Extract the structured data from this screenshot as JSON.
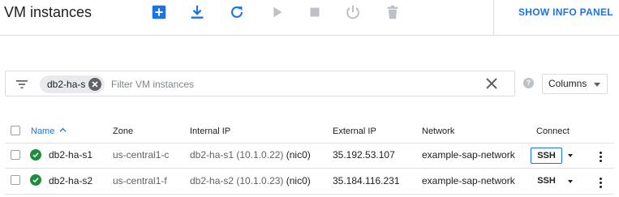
{
  "header": {
    "title": "VM instances",
    "info_panel_label": "SHOW INFO PANEL",
    "toolbar": [
      {
        "icon": "create-instance-icon",
        "enabled": true
      },
      {
        "icon": "import-vm-icon",
        "enabled": true
      },
      {
        "icon": "refresh-icon",
        "enabled": true
      },
      {
        "icon": "start-icon",
        "enabled": false
      },
      {
        "icon": "stop-icon",
        "enabled": false
      },
      {
        "icon": "reset-icon",
        "enabled": false
      },
      {
        "icon": "delete-icon",
        "enabled": false
      }
    ]
  },
  "filter": {
    "chip": "db2-ha-s",
    "placeholder": "Filter VM instances",
    "columns_label": "Columns"
  },
  "table": {
    "columns": [
      "Name",
      "Zone",
      "Internal IP",
      "External IP",
      "Network",
      "Connect"
    ],
    "rows": [
      {
        "name": "db2-ha-s1",
        "zone": "us-central1-c",
        "internal_ip": "db2-ha-s1 (10.1.0.22)",
        "nic": "(nic0)",
        "external_ip": "35.192.53.107",
        "network": "example-sap-network",
        "connect": "SSH"
      },
      {
        "name": "db2-ha-s2",
        "zone": "us-central1-f",
        "internal_ip": "db2-ha-s2 (10.1.0.23)",
        "nic": "(nic0)",
        "external_ip": "35.184.116.231",
        "network": "example-sap-network",
        "connect": "SSH"
      }
    ]
  },
  "colors": {
    "accent": "#1a73e8",
    "status_ok": "#1e8e3e",
    "disabled_icon": "#bdc1c6"
  }
}
